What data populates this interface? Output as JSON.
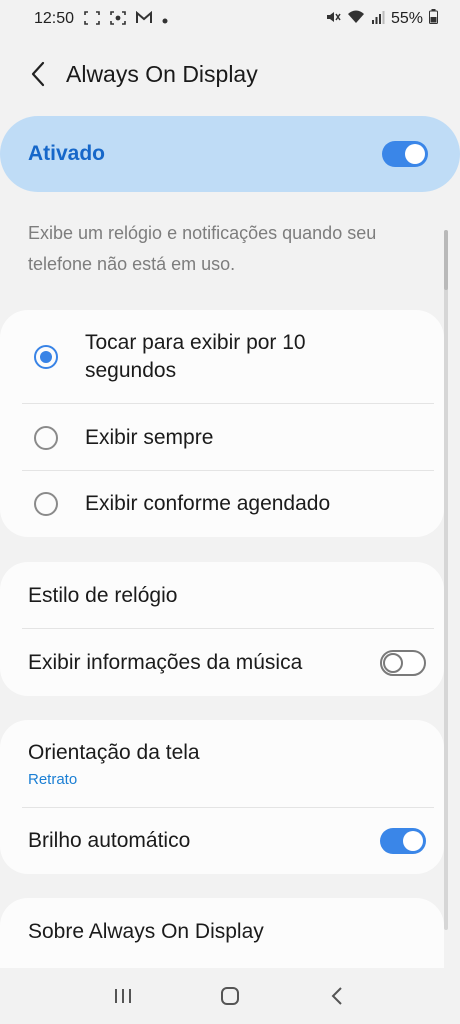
{
  "status_bar": {
    "time": "12:50",
    "battery": "55%",
    "left_icons": [
      "screenshot-icon",
      "screen-record-icon",
      "gmail-icon",
      "dot-icon"
    ],
    "right_icons": [
      "mute-icon",
      "wifi-icon",
      "signal-icon",
      "battery-icon"
    ]
  },
  "header": {
    "title": "Always On Display"
  },
  "master": {
    "label": "Ativado",
    "enabled": true
  },
  "description": "Exibe um relógio e notificações quando seu telefone não está em uso.",
  "display_mode": {
    "options": [
      {
        "label": "Tocar para exibir por 10 segundos",
        "selected": true
      },
      {
        "label": "Exibir sempre",
        "selected": false
      },
      {
        "label": "Exibir conforme agendado",
        "selected": false
      }
    ]
  },
  "style_card": {
    "clock_style": "Estilo de relógio",
    "music_info": "Exibir informações da música",
    "music_info_enabled": false
  },
  "screen_card": {
    "orientation": "Orientação da tela",
    "orientation_value": "Retrato",
    "auto_brightness": "Brilho automático",
    "auto_brightness_enabled": true
  },
  "about": "Sobre Always On Display",
  "colors": {
    "accent": "#3a86e8",
    "master_bg": "#bfdcf6",
    "master_label": "#1667c9",
    "background": "#f2f2f2"
  }
}
